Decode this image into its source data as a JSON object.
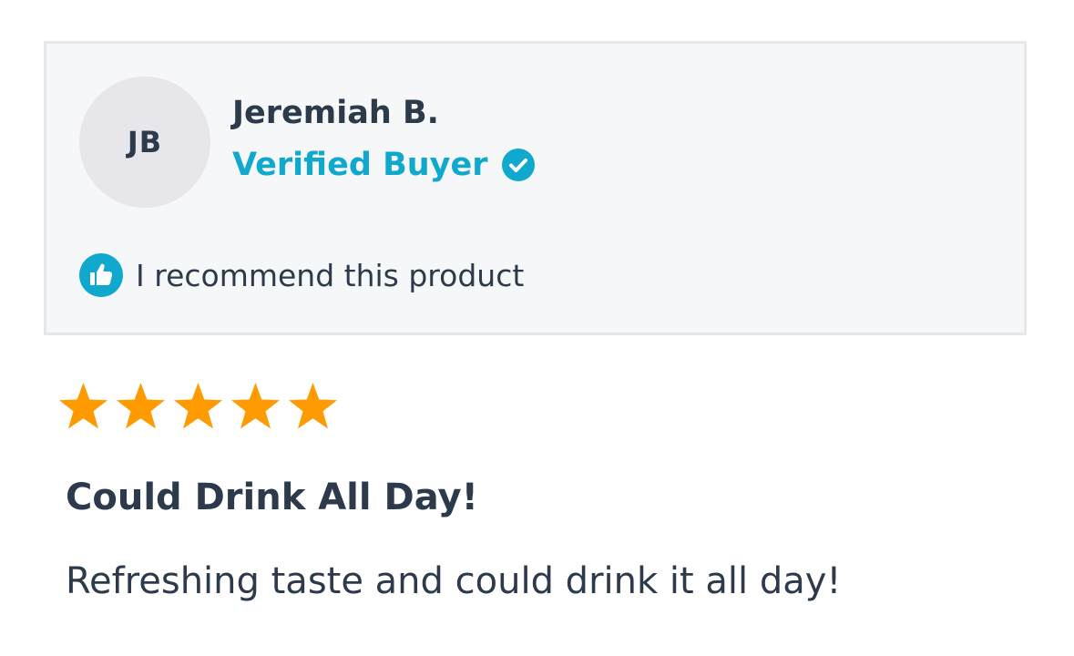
{
  "reviewer": {
    "initials": "JB",
    "name": "Jeremiah B.",
    "verified_label": "Verified Buyer",
    "verified_icon": "check-circle-icon",
    "recommend_text": "I recommend this product",
    "recommend_icon": "thumbs-up-icon"
  },
  "review": {
    "rating": 5,
    "rating_max": 5,
    "title": "Could Drink All Day!",
    "body": "Refreshing taste and could drink it all day!"
  },
  "colors": {
    "accent": "#10a9cd",
    "star": "#ff9a00",
    "text": "#2c3a4b",
    "card_bg": "#f6f7f9",
    "card_border": "#e6e7ea",
    "avatar_bg": "#e6e6eb"
  }
}
